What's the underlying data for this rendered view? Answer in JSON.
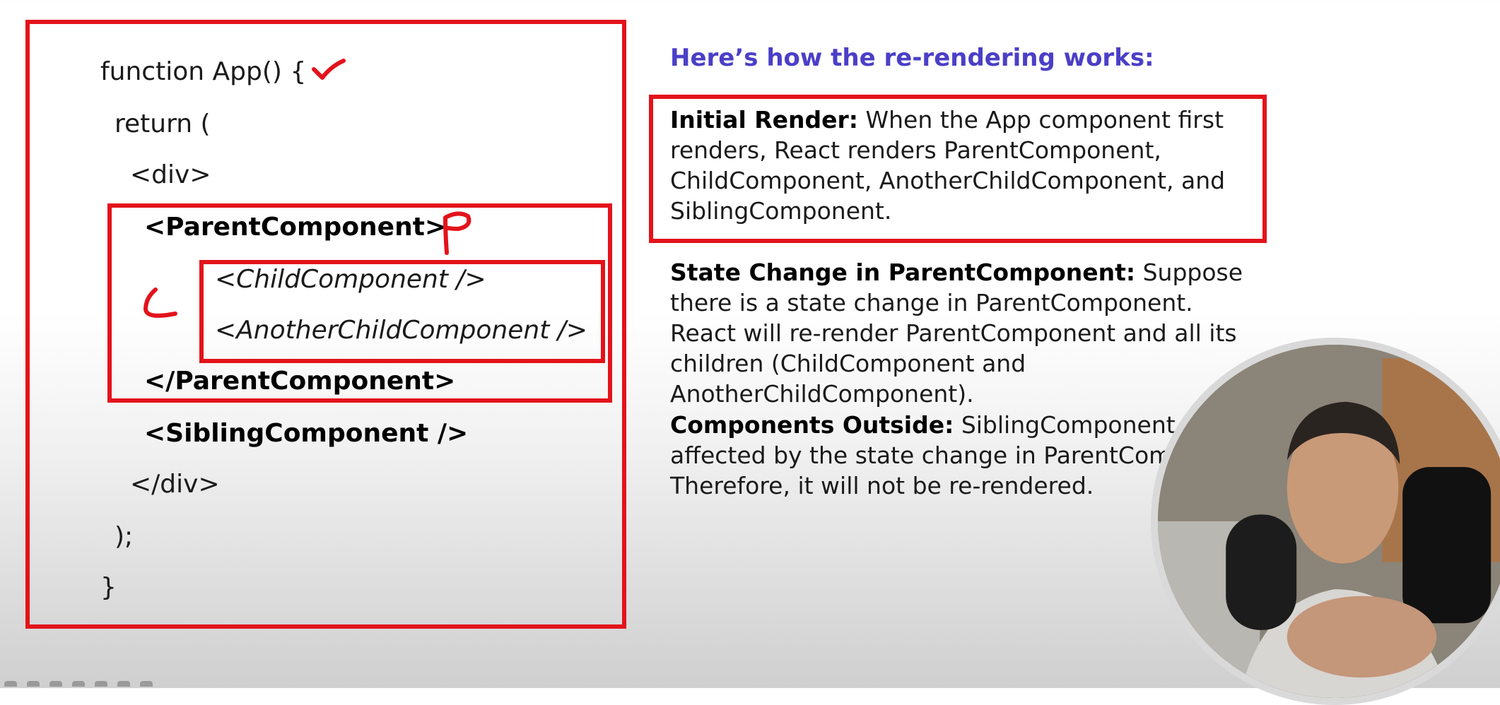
{
  "code": {
    "lines": [
      "function App() {",
      "return (",
      "<div>",
      "<ParentComponent>",
      "<ChildComponent />",
      "<AnotherChildComponent />",
      "</ParentComponent>",
      "<SiblingComponent />",
      "</div>",
      ");",
      "}"
    ]
  },
  "annotations": {
    "parent_letter": "P",
    "child_letter": "C"
  },
  "explanation": {
    "heading": "Here’s how the re-rendering works:",
    "sections": [
      {
        "title": "Initial Render:",
        "body": " When the App component first renders, React renders ParentComponent, ChildComponent, AnotherChildComponent, and SiblingComponent."
      },
      {
        "title": "State Change in ParentComponent:",
        "body": " Suppose there is a state change in ParentComponent. React will re-render ParentComponent and all its children (ChildComponent and AnotherChildComponent)."
      },
      {
        "title": "Components Outside:",
        "body": " SiblingComponent is affected by the state change in ParentCompo Therefore, it will not be re-rendered."
      }
    ]
  },
  "colors": {
    "highlight": "#e3131b",
    "heading": "#4b3fc7"
  }
}
